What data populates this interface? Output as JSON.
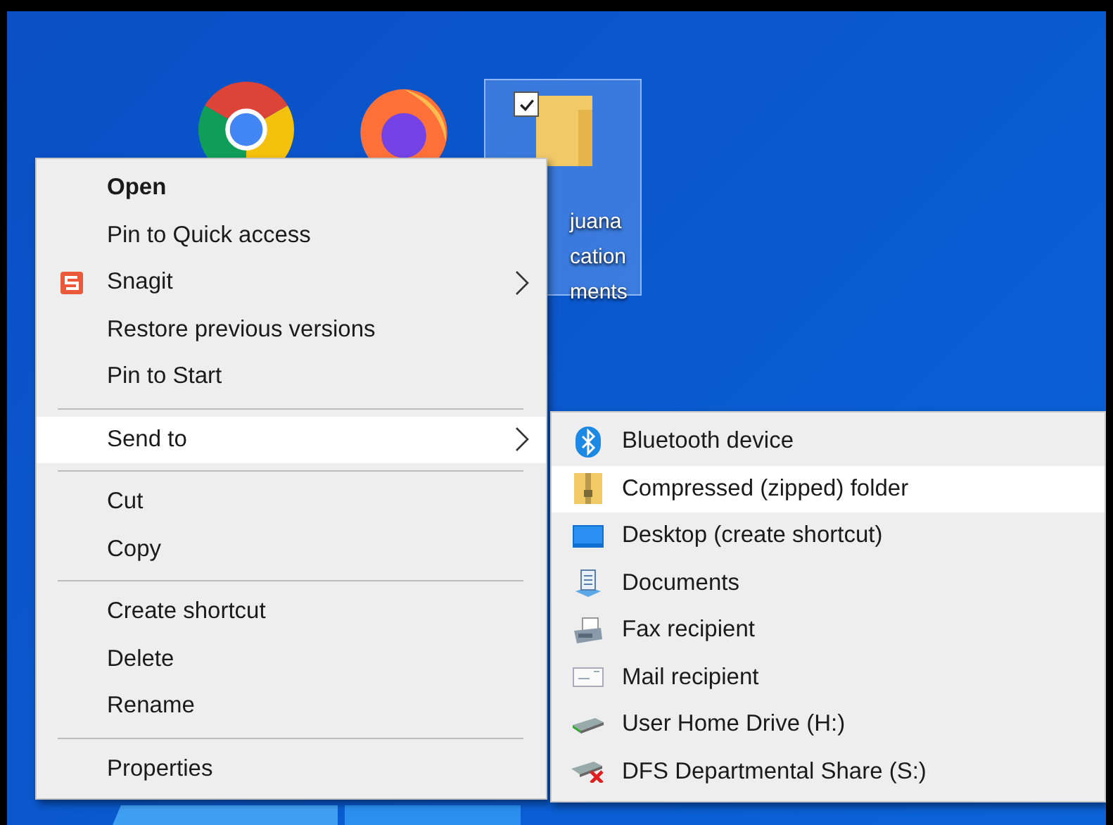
{
  "selected_desktop_icon": {
    "selected": true,
    "checked": true,
    "label_lines": [
      "juana",
      "cation",
      "ments"
    ]
  },
  "context_menu": {
    "items": [
      {
        "kind": "item",
        "label": "Open",
        "default": true,
        "selected": false,
        "submenu": false
      },
      {
        "kind": "item",
        "label": "Pin to Quick access",
        "default": false,
        "selected": false,
        "submenu": false
      },
      {
        "kind": "item",
        "label": "Snagit",
        "default": false,
        "selected": false,
        "submenu": true
      },
      {
        "kind": "item",
        "label": "Restore previous versions",
        "default": false,
        "selected": false,
        "submenu": false
      },
      {
        "kind": "item",
        "label": "Pin to Start",
        "default": false,
        "selected": false,
        "submenu": false
      },
      {
        "kind": "separator"
      },
      {
        "kind": "item",
        "label": "Send to",
        "default": false,
        "selected": true,
        "submenu": true
      },
      {
        "kind": "separator"
      },
      {
        "kind": "item",
        "label": "Cut",
        "default": false,
        "selected": false,
        "submenu": false
      },
      {
        "kind": "item",
        "label": "Copy",
        "default": false,
        "selected": false,
        "submenu": false
      },
      {
        "kind": "separator"
      },
      {
        "kind": "item",
        "label": "Create shortcut",
        "default": false,
        "selected": false,
        "submenu": false
      },
      {
        "kind": "item",
        "label": "Delete",
        "default": false,
        "selected": false,
        "submenu": false
      },
      {
        "kind": "item",
        "label": "Rename",
        "default": false,
        "selected": false,
        "submenu": false
      },
      {
        "kind": "separator"
      },
      {
        "kind": "item",
        "label": "Properties",
        "default": false,
        "selected": false,
        "submenu": false
      }
    ]
  },
  "send_to_menu": {
    "items": [
      {
        "label": "Bluetooth device",
        "selected": false
      },
      {
        "label": "Compressed (zipped) folder",
        "selected": true
      },
      {
        "label": "Desktop (create shortcut)",
        "selected": false
      },
      {
        "label": "Documents",
        "selected": false
      },
      {
        "label": "Fax recipient",
        "selected": false
      },
      {
        "label": "Mail recipient",
        "selected": false
      },
      {
        "label": "User Home Drive (H:)",
        "selected": false
      },
      {
        "label": "DFS Departmental Share (S:)",
        "selected": false
      }
    ]
  }
}
